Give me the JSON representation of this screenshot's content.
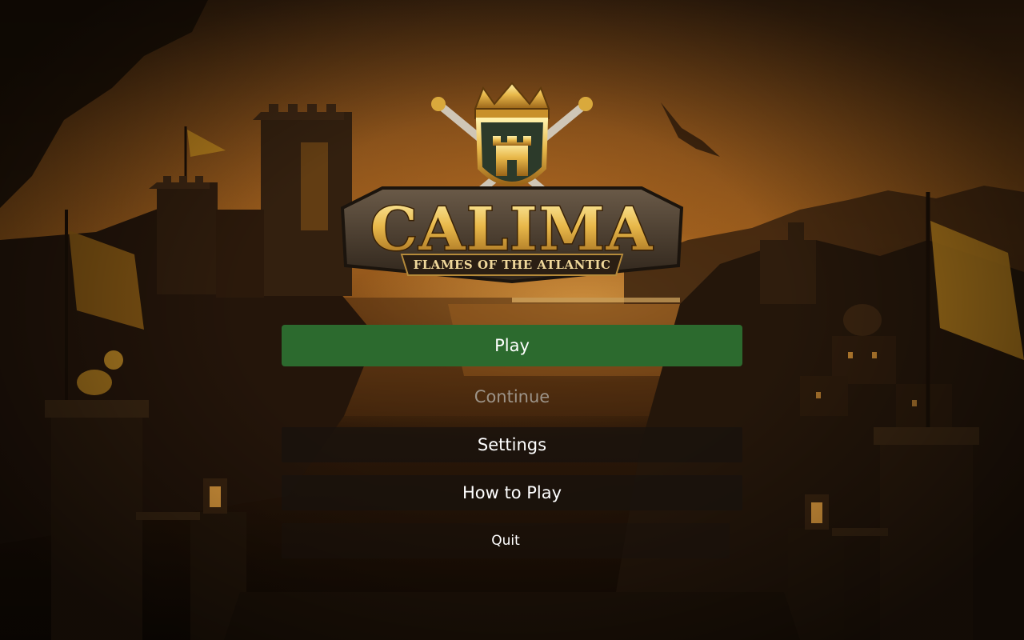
{
  "game": {
    "title": "CALIMA",
    "subtitle": "FLAMES OF THE ATLANTIC"
  },
  "menu": {
    "items": [
      {
        "id": "play",
        "label": "Play",
        "state": "primary"
      },
      {
        "id": "continue",
        "label": "Continue",
        "state": "disabled"
      },
      {
        "id": "settings",
        "label": "Settings",
        "state": "normal"
      },
      {
        "id": "how_to_play",
        "label": "How to Play",
        "state": "normal"
      },
      {
        "id": "quit",
        "label": "Quit",
        "state": "normal"
      }
    ]
  },
  "colors": {
    "play_button": "#2c6a2e",
    "disabled_text": "#9c9388",
    "button_text": "#ffffff",
    "logo_gold": "#e8b84a"
  }
}
